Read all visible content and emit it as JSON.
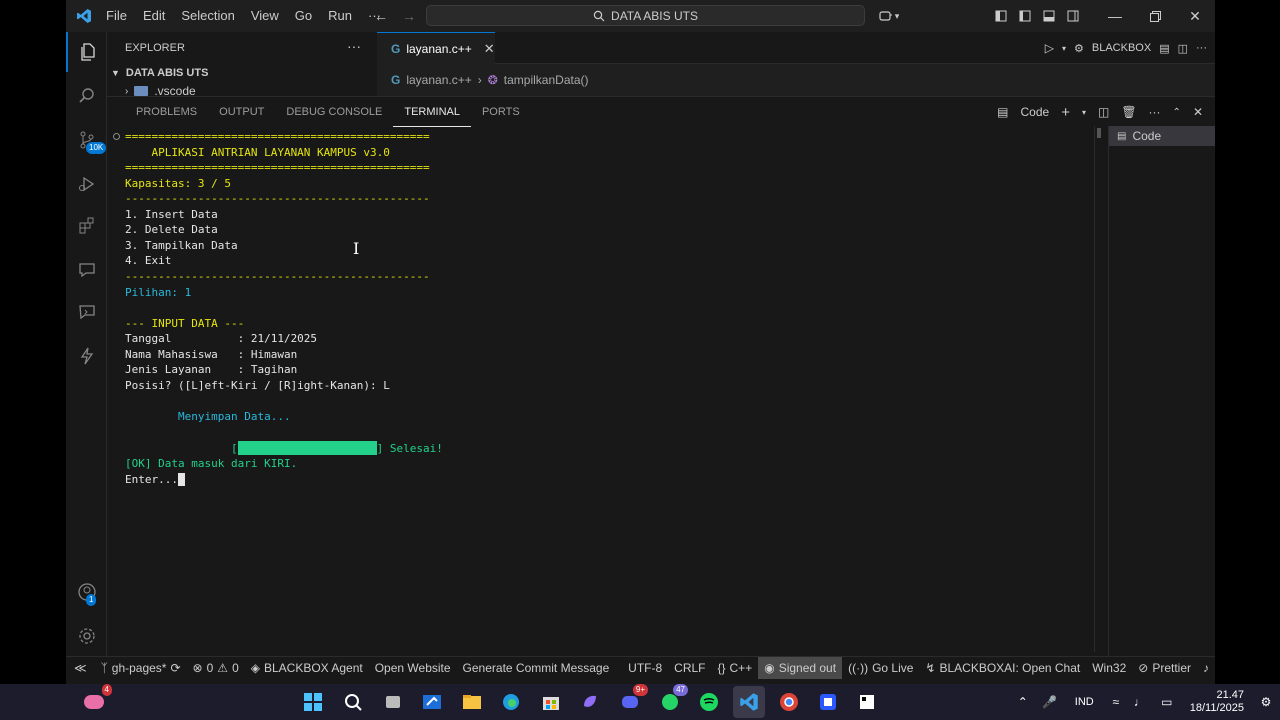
{
  "titlebar": {
    "menu": [
      "File",
      "Edit",
      "Selection",
      "View",
      "Go",
      "Run",
      "···"
    ],
    "search_text": "DATA ABIS UTS"
  },
  "sidebar": {
    "title": "EXPLORER",
    "more": "···",
    "folder": "DATA ABIS UTS",
    "subfolder": ".vscode"
  },
  "tabs": {
    "active_tab": "layanan.c++",
    "extension_label": "BLACKBOX"
  },
  "breadcrumb": {
    "file": "layanan.c++",
    "symbol": "tampilkanData()"
  },
  "panel": {
    "tabs": [
      "PROBLEMS",
      "OUTPUT",
      "DEBUG CONSOLE",
      "TERMINAL",
      "PORTS"
    ],
    "active_tab": "TERMINAL",
    "terminal_name": "Code",
    "terminal_list_entry": "Code"
  },
  "terminal": {
    "sep_eq": "==============================================",
    "sep_dash": "----------------------------------------------",
    "app_title": "    APLIKASI ANTRIAN LAYANAN KAMPUS v3.0",
    "capacity": "Kapasitas: 3 / 5",
    "menu_1": "1. Insert Data",
    "menu_2": "2. Delete Data",
    "menu_3": "3. Tampilkan Data",
    "menu_4": "4. Exit",
    "choice": "Pilihan: 1",
    "input_header": "--- INPUT DATA ---",
    "date": "Tanggal          : 21/11/2025",
    "name": "Nama Mahasiswa   : Himawan",
    "service": "Jenis Layanan    : Tagihan",
    "position": "Posisi? ([L]eft-Kiri / [R]ight-Kanan): L",
    "saving": "        Menyimpan Data...",
    "progress_open": "        [",
    "progress_close": "] Selesai!",
    "progress_value": 1.0,
    "ok": "[OK] Data masuk dari KIRI.",
    "enter": "Enter..."
  },
  "statusbar": {
    "branch": "gh-pages*",
    "errors": "0",
    "warnings": "0",
    "agent": "BLACKBOX Agent",
    "open_website": "Open Website",
    "commit": "Generate Commit Message",
    "encoding": "UTF-8",
    "eol": "CRLF",
    "language": "C++",
    "signed": "Signed out",
    "golive": "Go Live",
    "chat": "BLACKBOXAI: Open Chat",
    "platform": "Win32",
    "prettier": "Prettier"
  },
  "activitybar": {
    "source_control_badge": "10K",
    "accounts_badge": "1"
  },
  "taskbar": {
    "badge_first": "4",
    "badge_discord": "9+",
    "badge_whatsapp": "47",
    "language": "IND",
    "time": "21.47",
    "date": "18/11/2025"
  },
  "colors": {
    "accent": "#0078d4",
    "terminal_green": "#23d18b",
    "terminal_yellow": "#e5e510",
    "terminal_cyan": "#29b8db"
  }
}
